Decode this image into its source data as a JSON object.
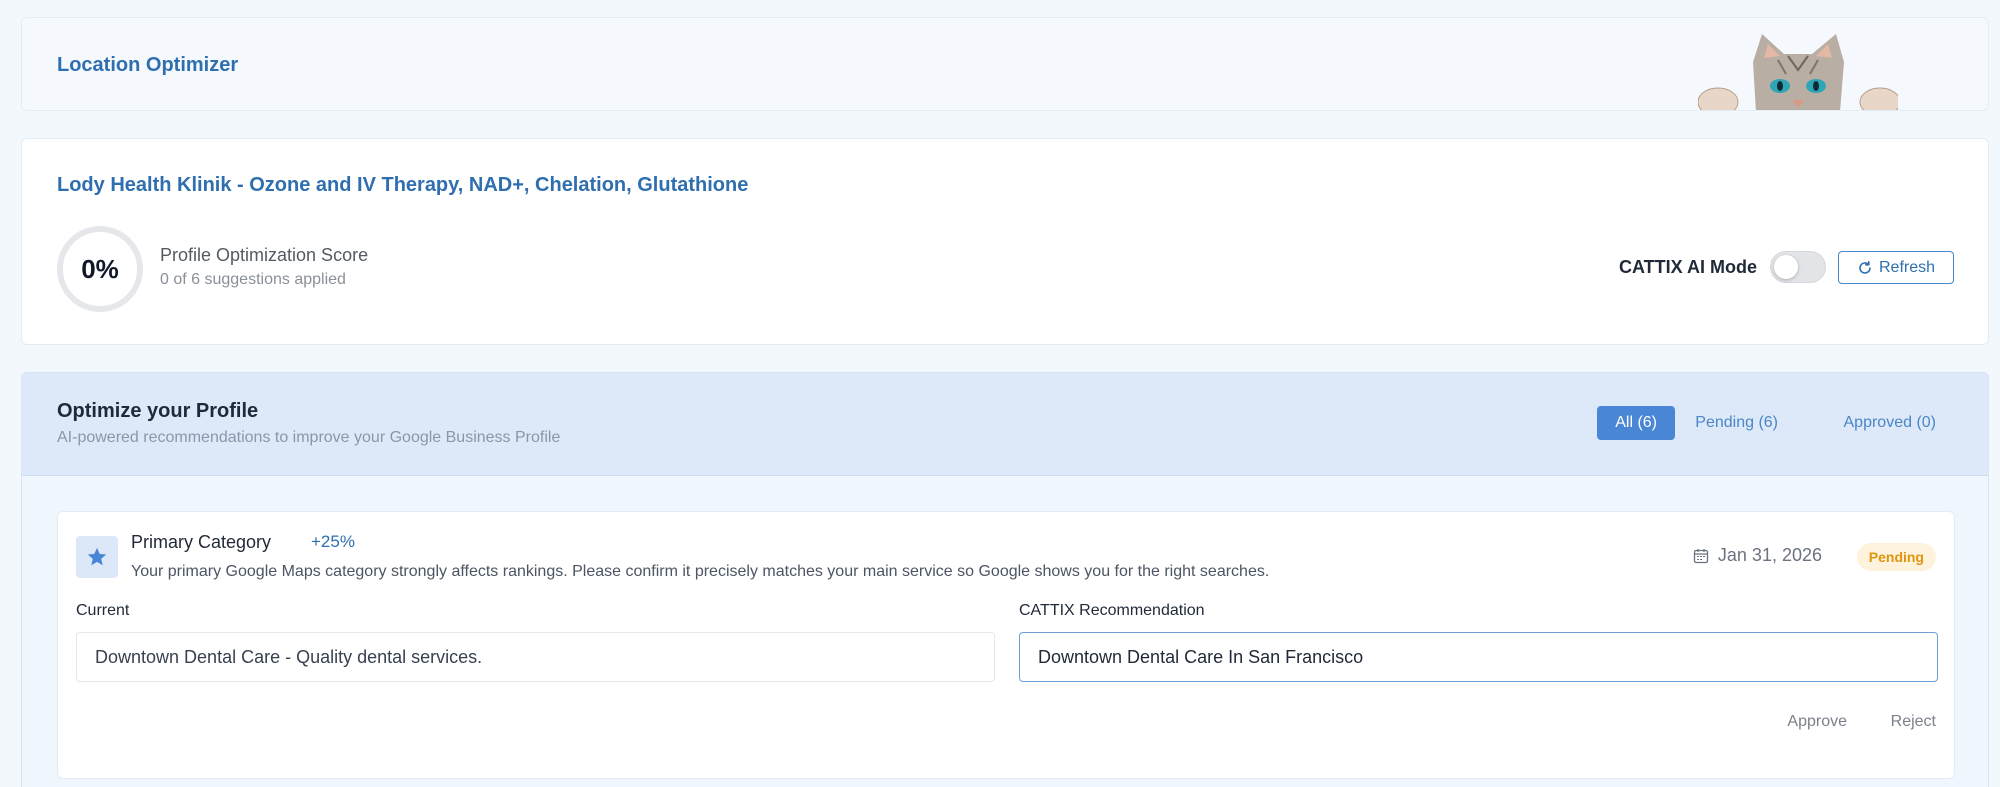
{
  "header": {
    "title": "Location Optimizer"
  },
  "location": {
    "name": "Lody Health Klinik - Ozone and IV Therapy, NAD+, Chelation, Glutathione",
    "score": "0%",
    "score_title": "Profile Optimization Score",
    "score_subtitle": "0 of 6 suggestions applied",
    "ai_mode_label": "CATTIX AI Mode",
    "ai_mode_on": false,
    "refresh_label": "Refresh"
  },
  "optimize": {
    "title": "Optimize your Profile",
    "subtitle": "AI-powered recommendations to improve your Google Business Profile",
    "tabs": [
      {
        "label": "All (6)",
        "active": true
      },
      {
        "label": "Pending (6)",
        "active": false
      },
      {
        "label": "Approved (0)",
        "active": false
      }
    ]
  },
  "suggestion": {
    "icon": "star-icon",
    "title": "Primary Category",
    "impact": "+25%",
    "description": "Your primary Google Maps category strongly affects rankings. Please confirm it precisely matches your main service so Google shows you for the right searches.",
    "date": "Jan 31, 2026",
    "status": "Pending",
    "current_label": "Current",
    "current_value": "Downtown Dental Care - Quality dental services.",
    "recommendation_label": "CATTIX Recommendation",
    "recommendation_value": "Downtown Dental Care In San Francisco",
    "approve_label": "Approve",
    "reject_label": "Reject"
  },
  "colors": {
    "brand": "#2f6fb0",
    "accent": "#4a86d6",
    "pending": "#e0940f"
  }
}
